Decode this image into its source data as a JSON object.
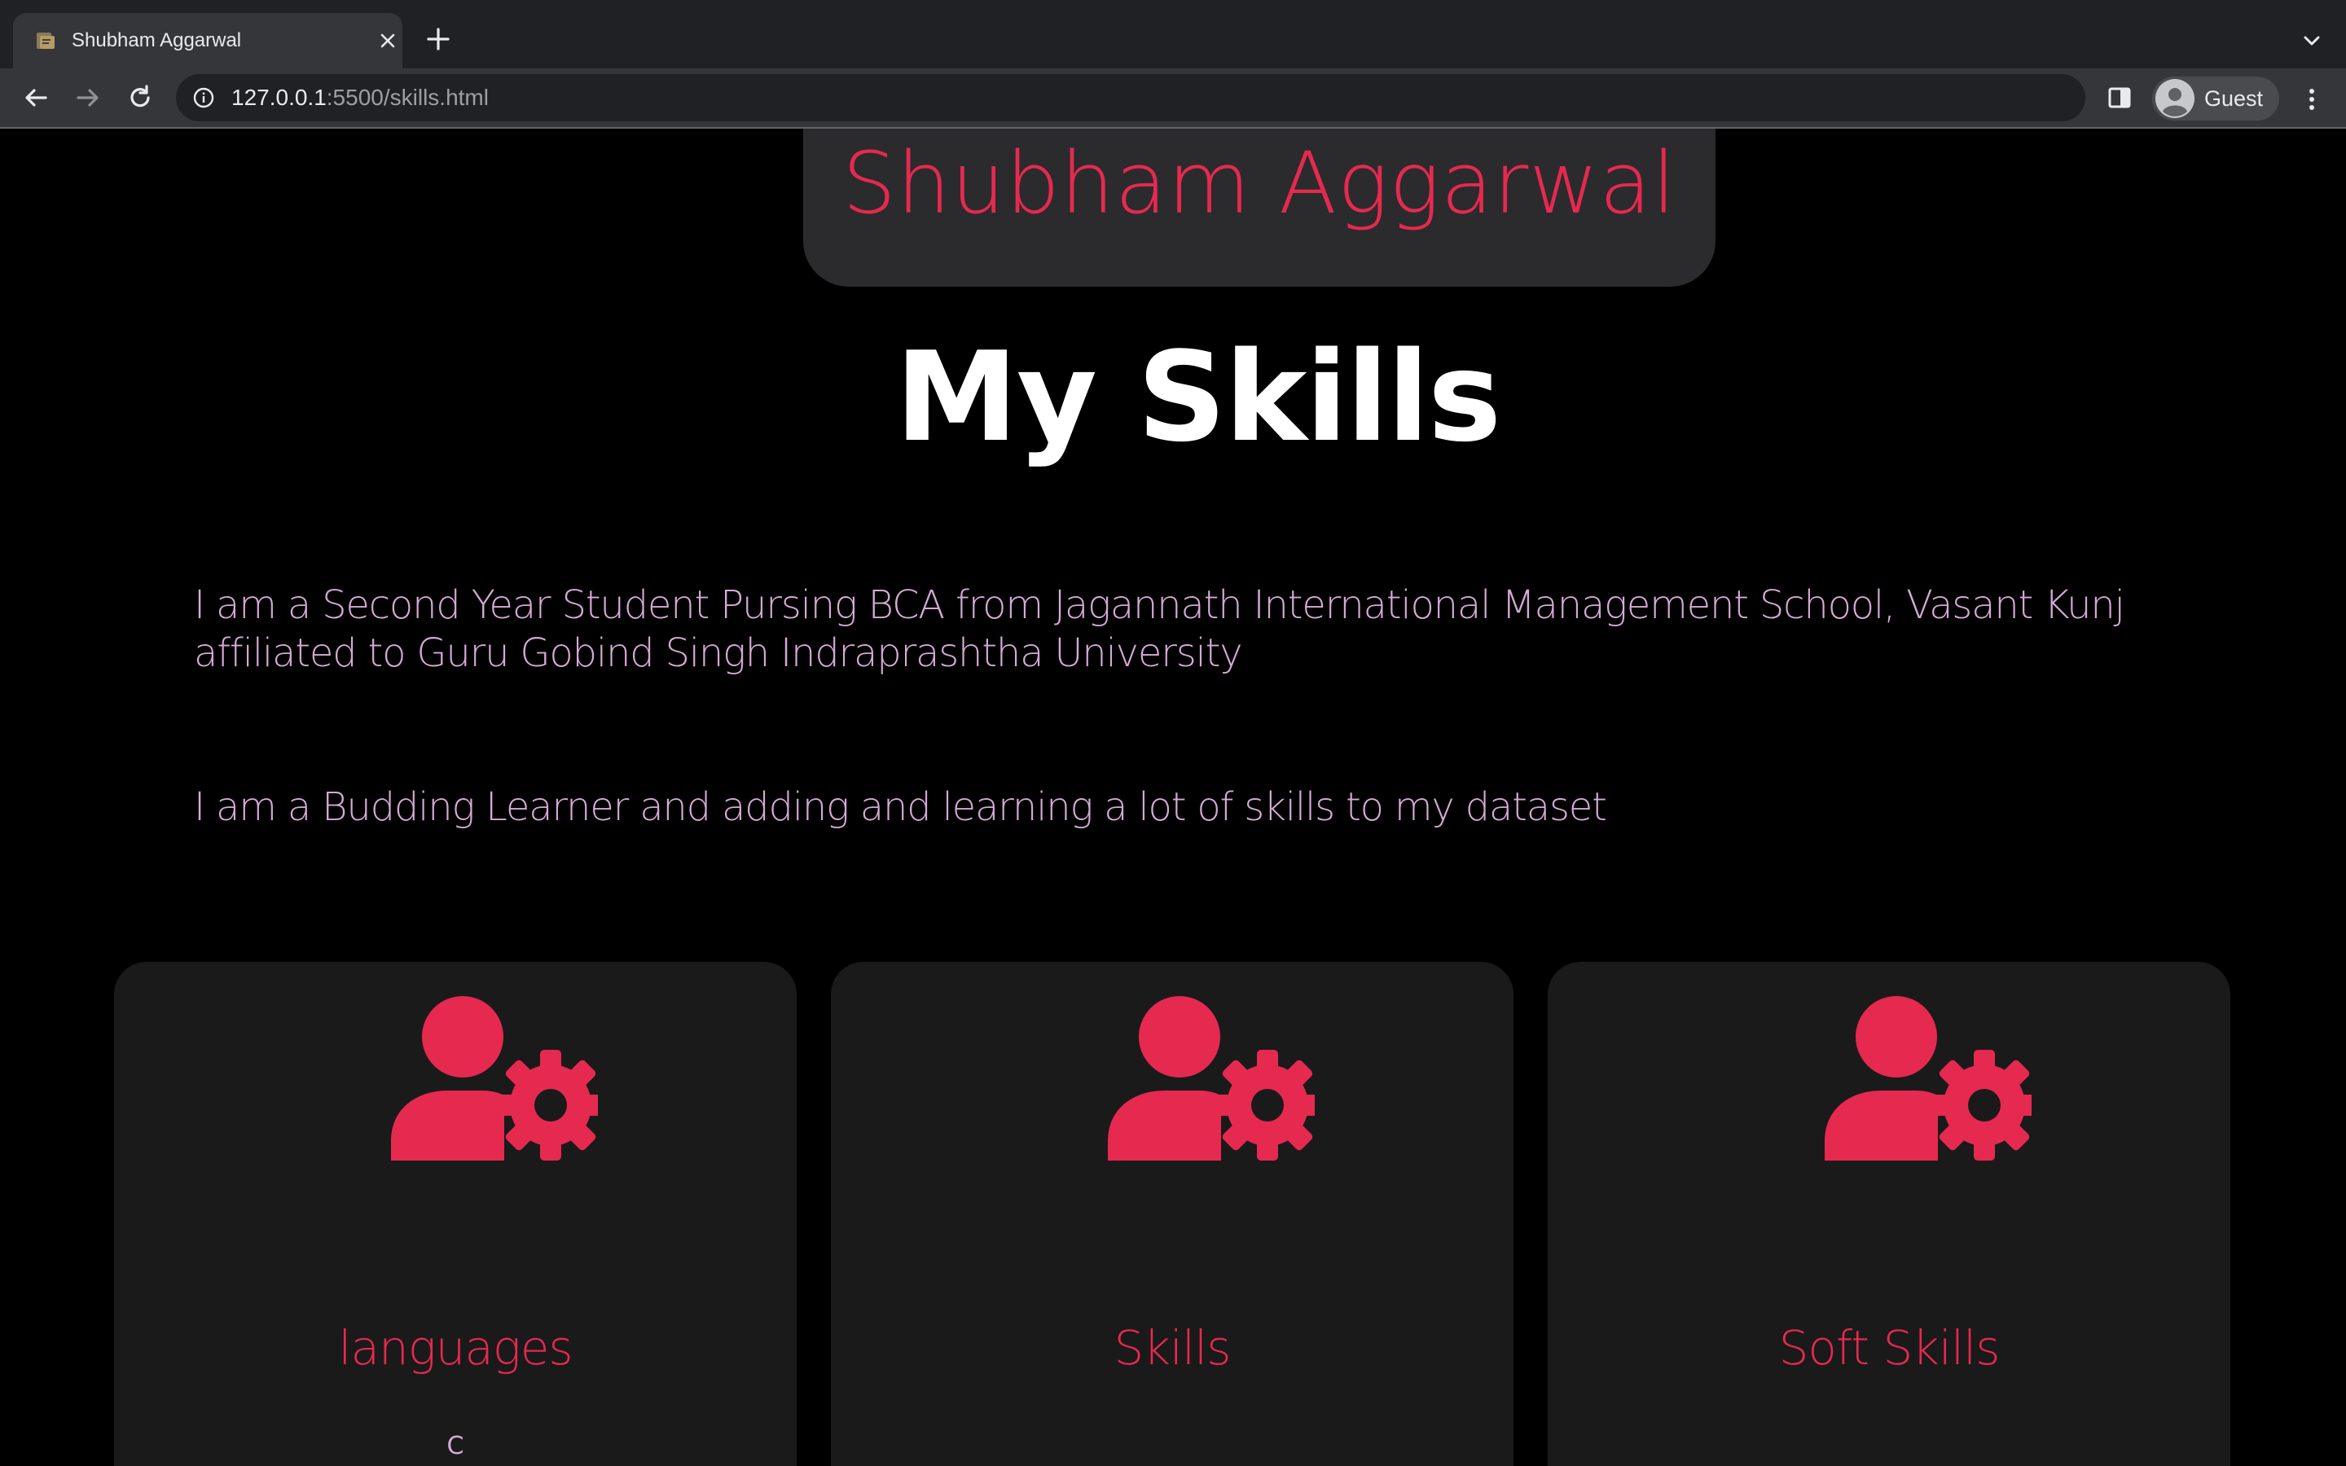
{
  "browser": {
    "tab_title": "Shubham Aggarwal",
    "url_host": "127.0.0.1",
    "url_rest": ":5500/skills.html",
    "profile_label": "Guest"
  },
  "page": {
    "name": "Shubham Aggarwal",
    "title": "My Skills",
    "intro_paragraph_1": "I am a Second Year Student Pursing BCA from Jagannath International Management School, Vasant Kunj affiliated to Guru Gobind Singh Indraprashtha University",
    "intro_paragraph_2": "I am a Budding Learner and adding and learning a lot of skills to my dataset",
    "cards": [
      {
        "icon": "user-gear-icon",
        "title": "languages",
        "first_item": "C"
      },
      {
        "icon": "user-gear-icon",
        "title": "Skills"
      },
      {
        "icon": "user-gear-icon",
        "title": "Soft Skills"
      }
    ]
  },
  "colors": {
    "accent": "#e6294f",
    "text_light": "#d5a9d6",
    "card_bg": "#1a1a1b",
    "page_bg": "#000000"
  }
}
